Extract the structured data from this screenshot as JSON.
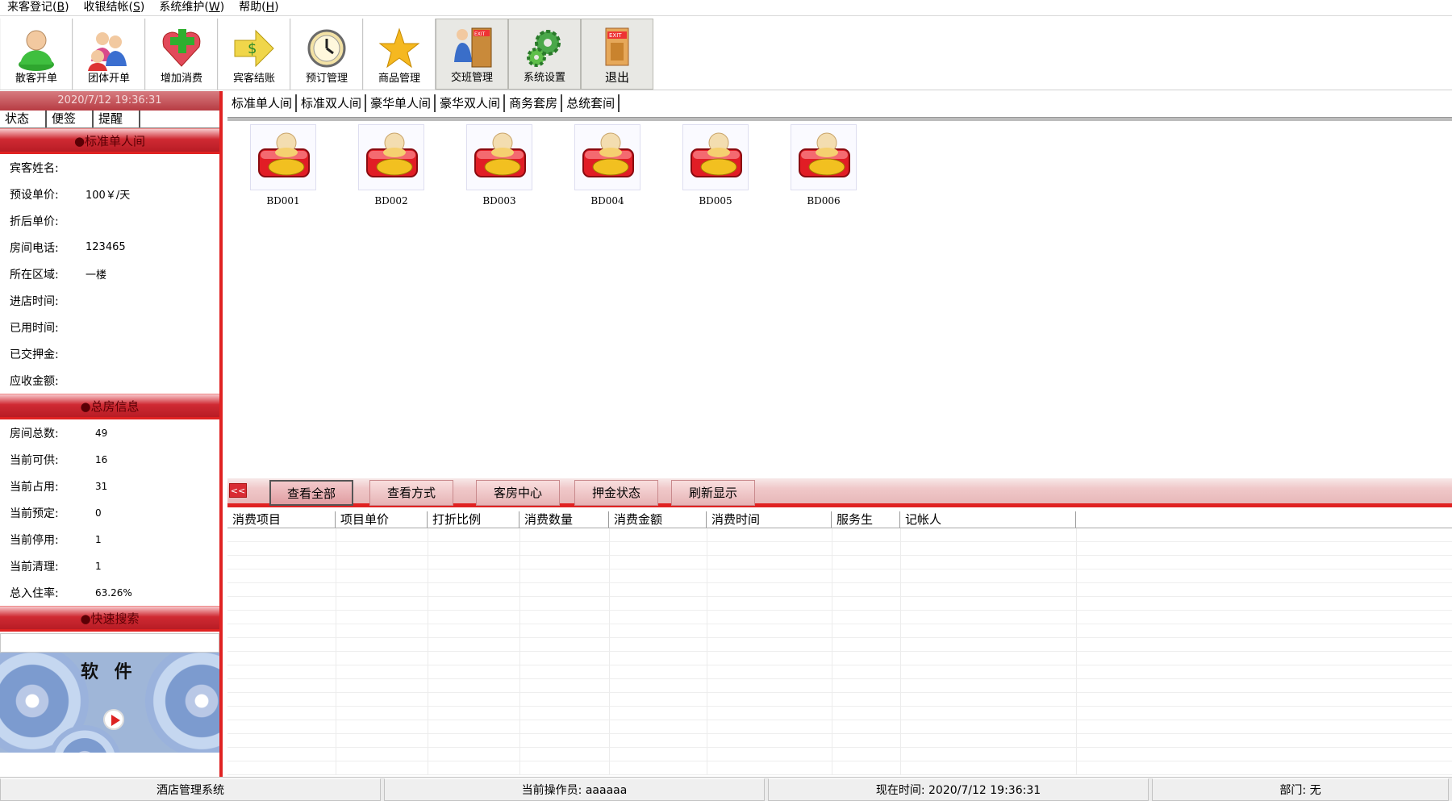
{
  "menu": [
    {
      "label": "来客登记(",
      "key": "B",
      "end": ")"
    },
    {
      "label": "收银结帐(",
      "key": "S",
      "end": ")"
    },
    {
      "label": "系统维护(",
      "key": "W",
      "end": ")"
    },
    {
      "label": "帮助(",
      "key": "H",
      "end": ")"
    }
  ],
  "toolbar": {
    "walkin": "散客开单",
    "group": "团体开单",
    "add_consumption": "增加消费",
    "guest_checkout": "宾客结账",
    "reservation": "预订管理",
    "goods": "商品管理",
    "shift": "交班管理",
    "settings": "系统设置",
    "exit": "退出"
  },
  "left": {
    "datetime": "2020/7/12 19:36:31",
    "tabs": [
      "状态",
      "便签",
      "提醒"
    ],
    "room_section_title": "●标准单人间",
    "room_info": [
      {
        "k": "宾客姓名:",
        "v": ""
      },
      {
        "k": "预设单价:",
        "v": "100￥/天"
      },
      {
        "k": "折后单价:",
        "v": ""
      },
      {
        "k": "房间电话:",
        "v": "123465"
      },
      {
        "k": "所在区域:",
        "v": "一楼"
      },
      {
        "k": "进店时间:",
        "v": ""
      },
      {
        "k": "已用时间:",
        "v": ""
      },
      {
        "k": "已交押金:",
        "v": ""
      },
      {
        "k": "应收金额:",
        "v": ""
      }
    ],
    "total_section_title": "●总房信息",
    "total_info": [
      {
        "k": "房间总数:",
        "v": "49"
      },
      {
        "k": "当前可供:",
        "v": "16"
      },
      {
        "k": "当前占用:",
        "v": "31"
      },
      {
        "k": "当前预定:",
        "v": "0"
      },
      {
        "k": "当前停用:",
        "v": "1"
      },
      {
        "k": "当前清理:",
        "v": "1"
      },
      {
        "k": "总入住率:",
        "v": "63.26%"
      }
    ],
    "search_section_title": "●快速搜索",
    "search_value": "",
    "banner_text": "软 件"
  },
  "room_tabs": [
    "标准单人间",
    "标准双人间",
    "豪华单人间",
    "豪华双人间",
    "商务套房",
    "总统套间"
  ],
  "rooms": [
    "BD001",
    "BD002",
    "BD003",
    "BD004",
    "BD005",
    "BD006"
  ],
  "action_bar": {
    "collapse": "<<",
    "buttons": [
      "查看全部",
      "查看方式",
      "客房中心",
      "押金状态",
      "刷新显示"
    ]
  },
  "table": {
    "columns": [
      "消费项目",
      "项目单价",
      "打折比例",
      "消费数量",
      "消费金额",
      "消费时间",
      "服务生",
      "记帐人"
    ]
  },
  "status": {
    "app": "酒店管理系统",
    "operator": "当前操作员: aaaaaa",
    "time": "现在时间: 2020/7/12 19:36:31",
    "dept": "部门: 无"
  },
  "colors": {
    "accent_red": "#e02222",
    "section_red": "#cf2a33"
  }
}
